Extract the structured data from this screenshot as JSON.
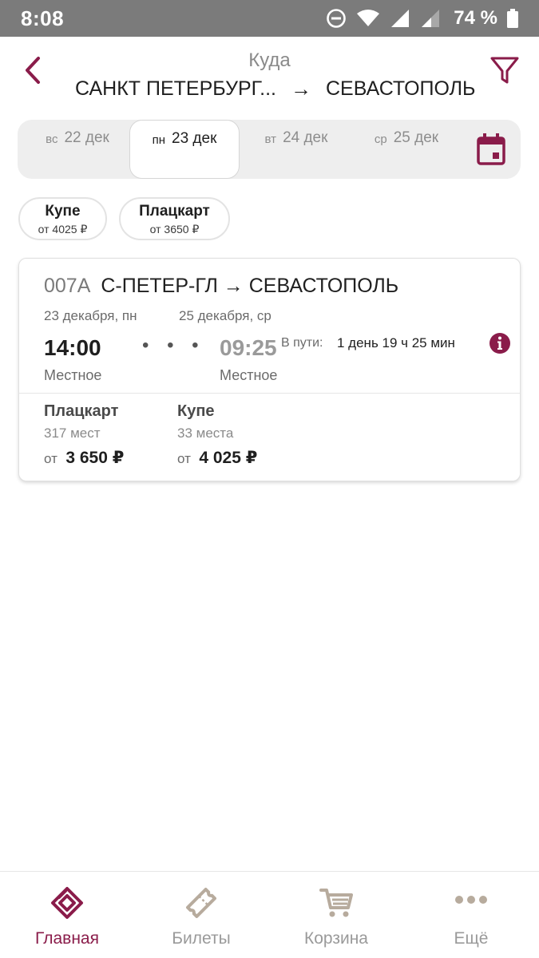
{
  "status_bar": {
    "time": "8:08",
    "battery": "74 %"
  },
  "header": {
    "subtitle": "Куда",
    "from": "САНКТ ПЕТЕРБУРГ...",
    "arrow": "→",
    "to": "СЕВАСТОПОЛЬ"
  },
  "dates": [
    {
      "dow": "вс",
      "date": "22 дек",
      "selected": false
    },
    {
      "dow": "пн",
      "date": "23 дек",
      "selected": true
    },
    {
      "dow": "вт",
      "date": "24 дек",
      "selected": false
    },
    {
      "dow": "ср",
      "date": "25 дек",
      "selected": false
    }
  ],
  "classes": [
    {
      "name": "Купе",
      "price": "от 4025 ₽"
    },
    {
      "name": "Плацкарт",
      "price": "от 3650 ₽"
    }
  ],
  "train": {
    "number": "007А",
    "route": "С-ПЕТЕР-ГЛ → СЕВАСТОПОЛЬ",
    "departure": {
      "date": "23 декабря, пн",
      "time": "14:00",
      "tz": "Местное"
    },
    "arrival": {
      "date": "25 декабря, ср",
      "time": "09:25",
      "tz": "Местное"
    },
    "dots": "• • •",
    "travel_label": "В пути:",
    "travel_time": "1 день 19 ч 25 мин",
    "fares": [
      {
        "name": "Плацкарт",
        "seats": "317 мест",
        "from": "от",
        "price": "3 650 ₽"
      },
      {
        "name": "Купе",
        "seats": "33 места",
        "from": "от",
        "price": "4 025 ₽"
      }
    ]
  },
  "nav": [
    {
      "label": "Главная",
      "icon": "home-logo-icon",
      "active": true
    },
    {
      "label": "Билеты",
      "icon": "ticket-icon",
      "active": false
    },
    {
      "label": "Корзина",
      "icon": "cart-icon",
      "active": false
    },
    {
      "label": "Ещё",
      "icon": "more-dots-icon",
      "active": false
    }
  ],
  "colors": {
    "accent": "#8a1c4a",
    "status_bar": "#7b7b7b",
    "muted": "#9a9a9a"
  }
}
